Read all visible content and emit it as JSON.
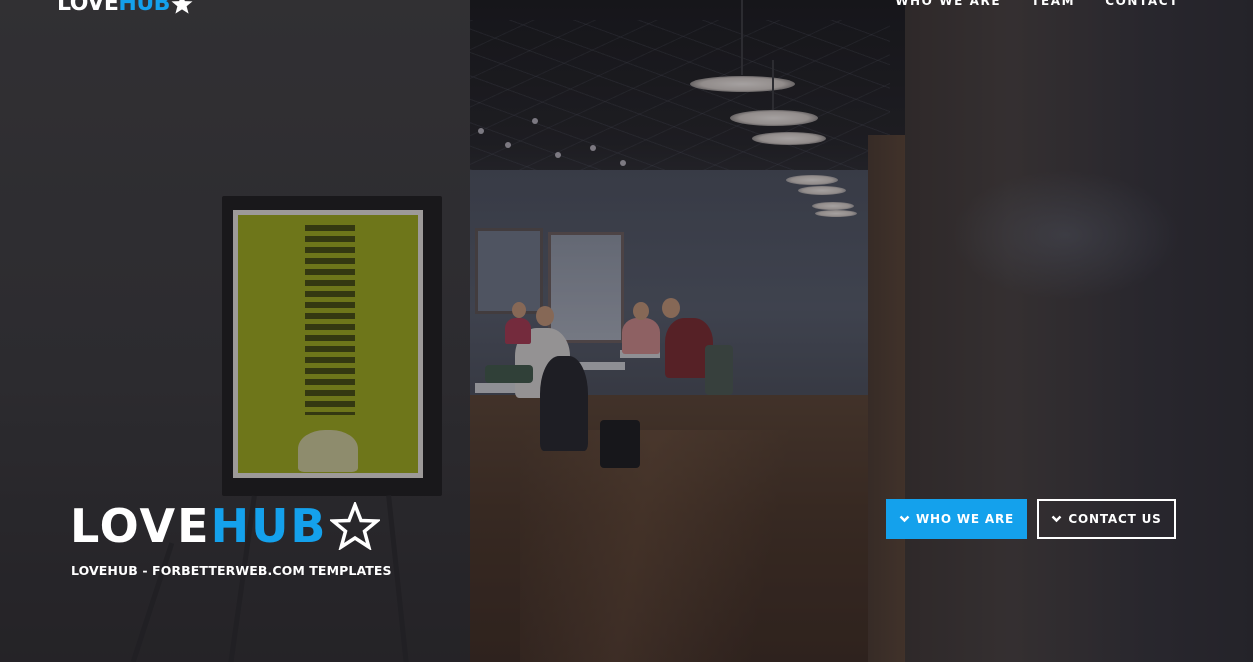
{
  "nav": {
    "logo_part1": "LOVE",
    "logo_part2": "HUB",
    "links": [
      "WHO WE ARE",
      "TEAM",
      "CONTACT"
    ]
  },
  "hero": {
    "title_part1": "LOVE",
    "title_part2": "HUB",
    "subtitle": "LOVEHUB - FORBETTERWEB.COM TEMPLATES",
    "buttons": [
      {
        "label": "WHO WE ARE",
        "icon": "chevron-down-icon"
      },
      {
        "label": "CONTACT US",
        "icon": "chevron-down-icon"
      }
    ]
  },
  "colors": {
    "accent": "#14a1ec",
    "text": "#ffffff"
  }
}
